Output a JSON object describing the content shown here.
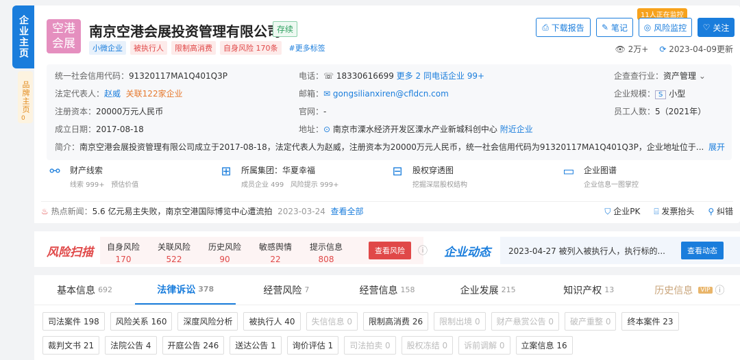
{
  "side": {
    "main": "企业主页",
    "brand": "品牌主页",
    "brand_count": "0"
  },
  "company": {
    "logo_line1": "空港",
    "logo_line2": "会展",
    "name": "南京空港会展投资管理有限公司",
    "status": "存续",
    "tags": [
      {
        "label": "小微企业",
        "kind": "blue"
      },
      {
        "label": "被执行人",
        "kind": "red"
      },
      {
        "label": "限制高消费",
        "kind": "red"
      },
      {
        "label": "自身风险 170条",
        "kind": "red"
      },
      {
        "label": "#更多标签",
        "kind": "more"
      }
    ]
  },
  "actions": {
    "download": "下载报告",
    "notes": "笔记",
    "monitor": "风险监控",
    "follow": "关注",
    "monitor_badge": "11人正在监控"
  },
  "meta": {
    "views": "2万+",
    "updated": "2023-04-09更新"
  },
  "info": {
    "credit_code_label": "统一社会信用代码：",
    "credit_code": "91320117MA1Q401Q3P",
    "phone_label": "电话：",
    "phone": "18330616699",
    "phone_more": "更多 2",
    "phone_same": "同电话企业 99+",
    "industry_label": "企查查行业：",
    "industry": "资产管理",
    "legal_label": "法定代表人：",
    "legal": "赵威",
    "legal_related": "关联122家企业",
    "email_label": "邮箱：",
    "email": "gongsilianxiren@cfldcn.com",
    "scale_label": "企业规模：",
    "scale_badge": "S",
    "scale": "小型",
    "capital_label": "注册资本：",
    "capital": "20000万元人民币",
    "website_label": "官网：",
    "website": "-",
    "staff_label": "员工人数：",
    "staff": "5（2021年）",
    "founded_label": "成立日期：",
    "founded": "2017-08-18",
    "address_label": "地址：",
    "address": "南京市溧水经济开发区溧水产业新城科创中心",
    "address_near": "附近企业",
    "intro_label": "简介：",
    "intro": "南京空港会展投资管理有限公司成立于2017-08-18，法定代表人为赵威，注册资本为20000万元人民币，统一社会信用代码为91320117MA1Q401Q3P，企业地址位于...",
    "expand": "展开"
  },
  "tiles": [
    {
      "title": "财产线索",
      "sub1": "线索 999+",
      "sub2": "预估价值"
    },
    {
      "title": "所属集团：华夏幸福",
      "sub1": "成员企业 499",
      "sub2": "风险提示 999+"
    },
    {
      "title": "股权穿透图",
      "sub1": "挖掘深层股权结构",
      "sub2": ""
    },
    {
      "title": "企业图谱",
      "sub1": "企业信息一图掌控",
      "sub2": ""
    }
  ],
  "news": {
    "label": "热点新闻：",
    "text": "5.6 亿元易主失败，南京空港国际博览中心遭流拍",
    "date": "2023-03-24",
    "all": "查看全部",
    "pk": "企业PK",
    "invoice": "发票抬头",
    "report": "纠错"
  },
  "risk": {
    "logo": "风险扫描",
    "items": [
      {
        "label": "自身风险",
        "value": "170"
      },
      {
        "label": "关联风险",
        "value": "522"
      },
      {
        "label": "历史风险",
        "value": "90"
      },
      {
        "label": "敏感舆情",
        "value": "22"
      },
      {
        "label": "提示信息",
        "value": "808"
      }
    ],
    "button": "查看风险"
  },
  "dynamic": {
    "logo": "企业动态",
    "text": "2023-04-27 被列入被执行人，执行标的...",
    "button": "查看动态"
  },
  "tabs": [
    {
      "label": "基本信息",
      "count": "692"
    },
    {
      "label": "法律诉讼",
      "count": "378"
    },
    {
      "label": "经营风险",
      "count": "7"
    },
    {
      "label": "经营信息",
      "count": "158"
    },
    {
      "label": "企业发展",
      "count": "215"
    },
    {
      "label": "知识产权",
      "count": "13"
    },
    {
      "label": "历史信息",
      "count": "",
      "vip": "VIP"
    }
  ],
  "chips": [
    {
      "label": "司法案件 198",
      "enabled": true
    },
    {
      "label": "风险关系 160",
      "enabled": true
    },
    {
      "label": "深度风险分析",
      "enabled": true
    },
    {
      "label": "被执行人 40",
      "enabled": true
    },
    {
      "label": "失信信息 0",
      "enabled": false
    },
    {
      "label": "限制高消费 26",
      "enabled": true
    },
    {
      "label": "限制出境 0",
      "enabled": false
    },
    {
      "label": "财产悬赏公告 0",
      "enabled": false
    },
    {
      "label": "破产重整 0",
      "enabled": false
    },
    {
      "label": "终本案件 23",
      "enabled": true
    },
    {
      "label": "裁判文书 21",
      "enabled": true
    },
    {
      "label": "法院公告 4",
      "enabled": true
    },
    {
      "label": "开庭公告 246",
      "enabled": true
    },
    {
      "label": "送达公告 1",
      "enabled": true
    },
    {
      "label": "询价评估 1",
      "enabled": true
    },
    {
      "label": "司法拍卖 0",
      "enabled": false
    },
    {
      "label": "股权冻结 0",
      "enabled": false
    },
    {
      "label": "诉前调解 0",
      "enabled": false
    },
    {
      "label": "立案信息 16",
      "enabled": true
    }
  ]
}
